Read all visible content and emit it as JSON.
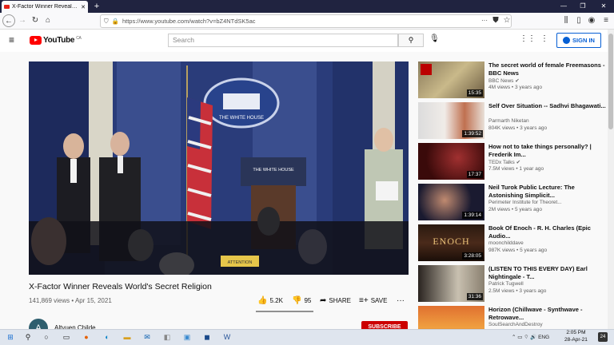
{
  "browser": {
    "tab_title": "X-Factor Winner Reveals W",
    "new_tab": "+",
    "url": "https://www.youtube.com/watch?v=bZ4NTdSK5ac",
    "window_buttons": [
      "—",
      "❐",
      "✕"
    ]
  },
  "youtube": {
    "logo_text": "YouTube",
    "region": "CA",
    "search_placeholder": "Search",
    "sign_in": "SIGN IN"
  },
  "video": {
    "overlay_seal_text": "THE WHITE HOUSE",
    "podium_text": "THE WHITE HOUSE",
    "sign_text": "ATTENTION",
    "title": "X-Factor Winner Reveals World's Secret Religion",
    "meta": "141,869 views • Apr 15, 2021",
    "likes": "5.2K",
    "dislikes": "95",
    "share": "SHARE",
    "save": "SAVE",
    "channel_initial": "A",
    "channel_name": "Altyuen Childe",
    "subscribe": "SUBSCRIBE"
  },
  "recommendations": [
    {
      "title": "The secret world of female Freemasons - BBC News",
      "channel": "BBC News",
      "views": "4M views • 3 years ago",
      "duration": "15:35"
    },
    {
      "title": "Self Over Situation -- Sadhvi Bhagawati...",
      "channel": "Parmarth Niketan",
      "views": "804K views • 3 years ago",
      "duration": "1:39:52"
    },
    {
      "title": "How not to take things personally? | Frederik Im...",
      "channel": "TEDx Talks",
      "views": "7.5M views • 1 year ago",
      "duration": "17:37"
    },
    {
      "title": "Neil Turok Public Lecture: The Astonishing Simplicit...",
      "channel": "Perimeter Institute for Theoret...",
      "views": "2M views • 5 years ago",
      "duration": "1:39:14"
    },
    {
      "title": "Book Of Enoch - R. H. Charles (Epic Audio...",
      "channel": "moonchilddave",
      "views": "987K views • 5 years ago",
      "duration": "3:28:05"
    },
    {
      "title": "(LISTEN TO THIS EVERY DAY) Earl Nightingale - T...",
      "channel": "Patrick Tugwell",
      "views": "2.5M views • 3 years ago",
      "duration": "31:36"
    },
    {
      "title": "Horizon (Chillwave - Synthwave - Retrowave...",
      "channel": "SoulSearchAndDestroy",
      "views": "",
      "duration": ""
    }
  ],
  "thumb_texts": {
    "enoch": "ENOCH"
  },
  "taskbar": {
    "language": "ENG",
    "time": "2:05 PM",
    "date": "28-Apr-21",
    "notifications": "24"
  }
}
